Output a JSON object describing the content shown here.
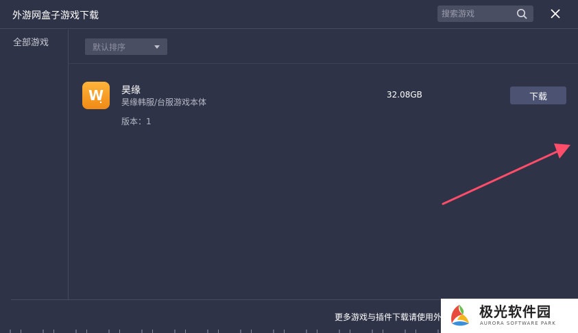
{
  "window": {
    "title": "外游网盒子游戏下载"
  },
  "search": {
    "placeholder": "搜索游戏"
  },
  "sidebar": {
    "items": [
      {
        "label": "全部游戏"
      }
    ]
  },
  "sort": {
    "selected": "默认排序"
  },
  "games": [
    {
      "name": "昊缘",
      "description": "昊缘韩服/台服游戏本体",
      "version": "版本：1",
      "size": "32.08GB",
      "download_label": "下载",
      "icon_letter": "W"
    }
  ],
  "footer": {
    "text": "更多游戏与插件下载请使用外"
  },
  "watermark": {
    "title": "极光软件园",
    "subtitle": "AURORA SOFTWARE PARK"
  },
  "colors": {
    "background": "#2f3347",
    "panel": "#4a4e63",
    "button": "#4b5272",
    "icon_orange": "#f6a12a",
    "arrow": "#ff4d6a"
  },
  "icons": {
    "search": "search-icon",
    "close": "close-icon",
    "dropdown": "caret-down-icon"
  }
}
